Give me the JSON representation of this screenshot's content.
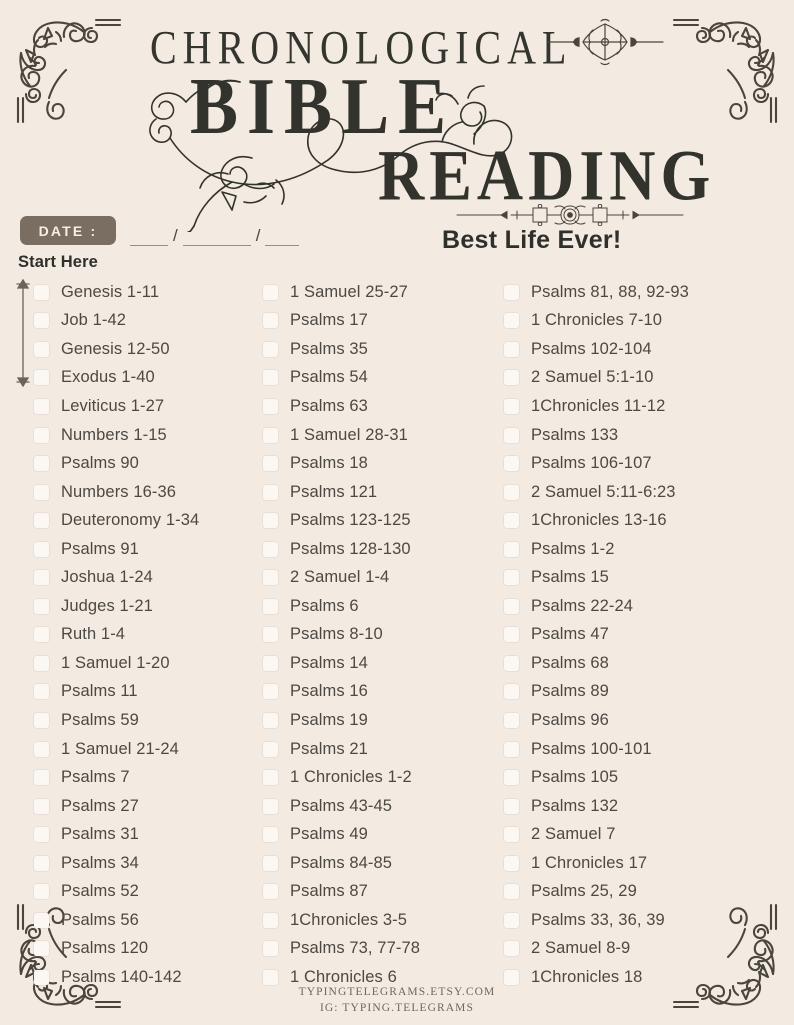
{
  "header": {
    "title_line1": "CHRONOLOGICAL",
    "title_line2": "BIBLE",
    "title_line3": "READING",
    "tagline": "Best Life Ever!",
    "date_label": "DATE :",
    "date_value_1": "",
    "date_value_2": "",
    "date_value_3": "",
    "date_separator": "/",
    "start_here": "Start Here"
  },
  "colors": {
    "page_background": "#f3eae1",
    "ink": "#33332e",
    "text": "#4c4944",
    "badge_background": "#7a6d62",
    "badge_text": "#f6efe7",
    "checkbox_fill": "#fbf7f2",
    "ornament": "#4a463f",
    "rule": "#9b8e80"
  },
  "columns": [
    {
      "index": 1,
      "items": [
        "Genesis 1-11",
        "Job 1-42",
        "Genesis 12-50",
        "Exodus 1-40",
        "Leviticus 1-27",
        "Numbers 1-15",
        "Psalms 90",
        "Numbers 16-36",
        "Deuteronomy 1-34",
        "Psalms 91",
        "Joshua 1-24",
        "Judges 1-21",
        "Ruth 1-4",
        "1 Samuel 1-20",
        "Psalms 11",
        "Psalms 59",
        "1 Samuel 21-24",
        "Psalms 7",
        "Psalms 27",
        "Psalms 31",
        "Psalms 34",
        "Psalms 52",
        "Psalms 56",
        "Psalms 120",
        "Psalms 140-142"
      ]
    },
    {
      "index": 2,
      "items": [
        "1 Samuel 25-27",
        "Psalms 17",
        "Psalms 35",
        "Psalms 54",
        "Psalms 63",
        "1 Samuel 28-31",
        "Psalms 18",
        "Psalms 121",
        "Psalms 123-125",
        "Psalms 128-130",
        "2 Samuel 1-4",
        "Psalms 6",
        "Psalms 8-10",
        "Psalms 14",
        "Psalms 16",
        "Psalms 19",
        "Psalms 21",
        "1 Chronicles 1-2",
        "Psalms 43-45",
        "Psalms 49",
        "Psalms 84-85",
        "Psalms 87",
        "1Chronicles 3-5",
        "Psalms 73, 77-78",
        "1 Chronicles 6"
      ]
    },
    {
      "index": 3,
      "items": [
        "Psalms 81, 88, 92-93",
        "1 Chronicles 7-10",
        "Psalms 102-104",
        "2 Samuel 5:1-10",
        "1Chronicles 11-12",
        "Psalms 133",
        "Psalms 106-107",
        "2 Samuel 5:11-6:23",
        "1Chronicles 13-16",
        "Psalms 1-2",
        "Psalms 15",
        "Psalms 22-24",
        "Psalms 47",
        "Psalms 68",
        "Psalms 89",
        "Psalms 96",
        "Psalms 100-101",
        "Psalms 105",
        "Psalms 132",
        "2 Samuel 7",
        "1 Chronicles 17",
        "Psalms 25, 29",
        "Psalms 33, 36, 39",
        "2 Samuel 8-9",
        "1Chronicles 18"
      ]
    }
  ],
  "footer": {
    "line1": "TYPINGTELEGRAMS.ETSY.COM",
    "line2": "IG: TYPING.TELEGRAMS"
  }
}
